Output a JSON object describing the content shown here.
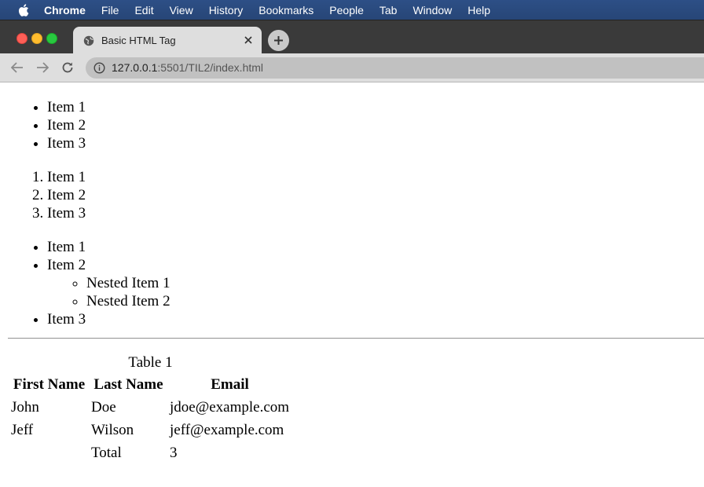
{
  "menubar": {
    "app": "Chrome",
    "items": [
      "File",
      "Edit",
      "View",
      "History",
      "Bookmarks",
      "People",
      "Tab",
      "Window",
      "Help"
    ]
  },
  "tab": {
    "title": "Basic HTML Tag"
  },
  "omnibox": {
    "host": "127.0.0.1",
    "path": ":5501/TIL2/index.html"
  },
  "page": {
    "unordered_list": [
      "Item 1",
      "Item 2",
      "Item 3"
    ],
    "ordered_list": [
      "Item 1",
      "Item 2",
      "Item 3"
    ],
    "nested_list": {
      "item1": "Item 1",
      "item2": "Item 2",
      "nested": [
        "Nested Item 1",
        "Nested Item 2"
      ],
      "item3": "Item 3"
    },
    "table": {
      "caption": "Table 1",
      "headers": [
        "First Name",
        "Last Name",
        "Email"
      ],
      "rows": [
        [
          "John",
          "Doe",
          "jdoe@example.com"
        ],
        [
          "Jeff",
          "Wilson",
          "jeff@example.com"
        ]
      ],
      "footer": [
        "",
        "Total",
        "3"
      ]
    }
  },
  "colors": {
    "menubar": "#2d4f86",
    "tabstrip": "#3a3a3a",
    "active_tab": "#dedede",
    "toolbar": "#dedede",
    "omnibox": "#c1c1c1"
  }
}
